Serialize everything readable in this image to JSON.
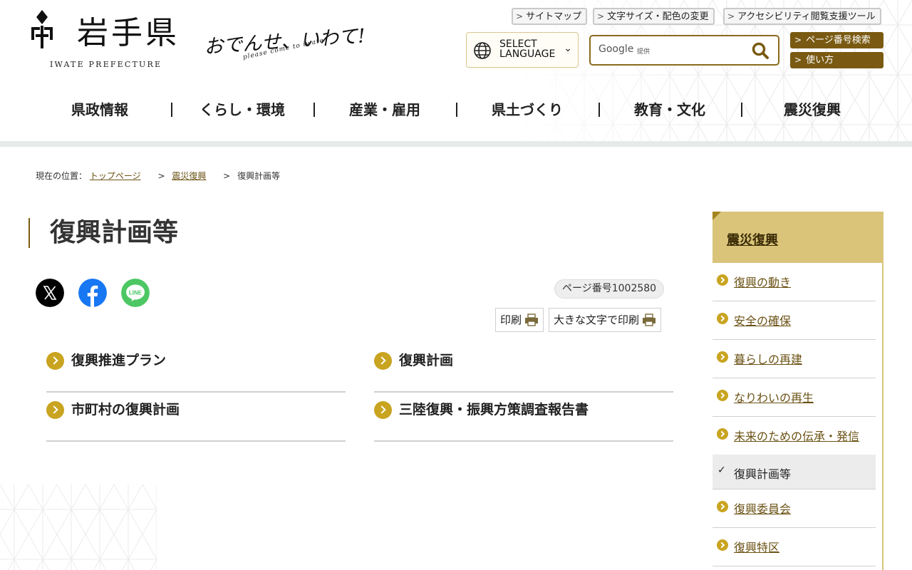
{
  "header": {
    "logo_title": "岩手県",
    "logo_sub": "IWATE PREFECTURE",
    "slogan": "おでんせ、いわて!",
    "slogan_sub": "please come to iwate",
    "utility_links": [
      "サイトマップ",
      "文字サイズ・配色の変更",
      "アクセシビリティ閲覧支援ツール"
    ],
    "language": {
      "line1": "SELECT",
      "line2": "LANGUAGE"
    },
    "search": {
      "brand": "Google",
      "provided_by": "提供"
    },
    "side_buttons": [
      "ページ番号検索",
      "使い方"
    ],
    "accent_color": "#7a5a12"
  },
  "nav": [
    "県政情報",
    "くらし・環境",
    "産業・雇用",
    "県土づくり",
    "教育・文化",
    "震災復興"
  ],
  "breadcrumb": {
    "prefix": "現在の位置：",
    "items": [
      "トップページ",
      "震災復興",
      "復興計画等"
    ],
    "separator": ">"
  },
  "main": {
    "title": "復興計画等",
    "share_icons": [
      "x-icon",
      "facebook-icon",
      "line-icon"
    ],
    "line_label": "LINE",
    "page_number": "ページ番号1002580",
    "print": "印刷",
    "print_large": "大きな文字で印刷",
    "links": [
      "復興推進プラン",
      "復興計画",
      "市町村の復興計画",
      "三陸復興・振興方策調査報告書"
    ]
  },
  "sidebar": {
    "title": "震災復興",
    "items": [
      {
        "label": "復興の動き"
      },
      {
        "label": "安全の確保"
      },
      {
        "label": "暮らしの再建"
      },
      {
        "label": "なりわいの再生"
      },
      {
        "label": "未来のための伝承・発信"
      },
      {
        "label": "復興計画等",
        "current": true
      },
      {
        "label": "復興委員会"
      },
      {
        "label": "復興特区"
      }
    ],
    "highlight_color": "#d9c47a"
  }
}
